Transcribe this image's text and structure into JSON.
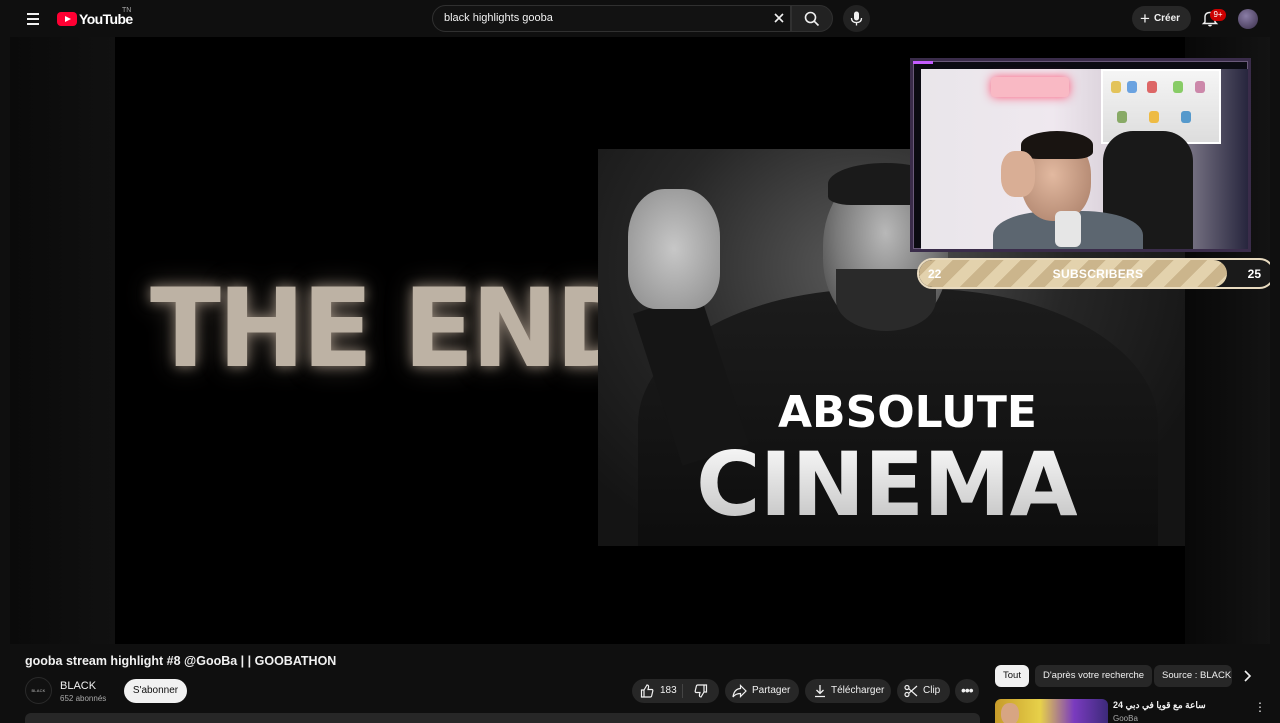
{
  "header": {
    "logo_text": "YouTube",
    "logo_country": "TN",
    "search_value": "black highlights gooba",
    "create_label": "Créer",
    "notifications_badge": "9+"
  },
  "player": {
    "thumb_text_left": "THE END",
    "thumb_text_top": "ABSOLUTE",
    "thumb_text_bottom": "CINEMA",
    "overlay": {
      "sub_start": "22",
      "sub_label": "SUBSCRIBERS",
      "sub_goal": "25",
      "sub_progress": 0.87
    }
  },
  "video": {
    "title": "gooba stream highlight #8 @GooBa | | GOOBATHON",
    "channel": {
      "avatar_text": "BLACK",
      "name": "BLACK",
      "subscribers": "652 abonnés",
      "subscribe_label": "S'abonner"
    },
    "actions": {
      "likes": "183",
      "share_label": "Partager",
      "download_label": "Télécharger",
      "clip_label": "Clip"
    }
  },
  "sidebar": {
    "chips": [
      "Tout",
      "D'après votre recherche",
      "Source : BLACK"
    ],
    "recommendation": {
      "title": "24 ساعة مع قويا في دبي",
      "channel": "GooBa"
    }
  },
  "colors": {
    "accent_red": "#ff0033",
    "background": "#0f0f0f",
    "pill_bg": "#272727"
  }
}
